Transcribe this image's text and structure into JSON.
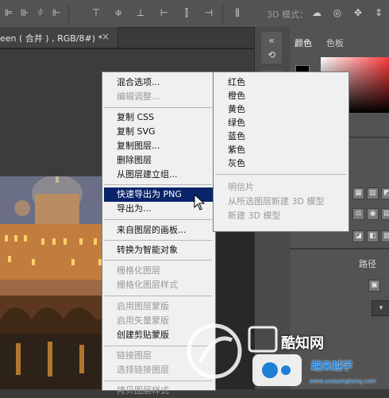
{
  "toolbar": {
    "mode_label": "3D 模式："
  },
  "document": {
    "tab_title": "een ( 合并 ) , RGB/8#) *",
    "close_glyph": "×"
  },
  "right_panel": {
    "tabs": [
      "颜色",
      "色板"
    ],
    "path_label": "路径",
    "select_glyph": "▾"
  },
  "context_menu": {
    "items": [
      {
        "label": "混合选项...",
        "enabled": true
      },
      {
        "label": "编辑调整...",
        "enabled": false
      },
      {
        "label": "复制 CSS",
        "enabled": true
      },
      {
        "label": "复制 SVG",
        "enabled": true
      },
      {
        "label": "复制图层...",
        "enabled": true
      },
      {
        "label": "删除图层",
        "enabled": true
      },
      {
        "label": "从图层建立组...",
        "enabled": true
      },
      {
        "label": "快速导出为 PNG",
        "enabled": true,
        "highlighted": true
      },
      {
        "label": "导出为...",
        "enabled": true
      },
      {
        "label": "来自图层的画板...",
        "enabled": true
      },
      {
        "label": "转换为智能对象",
        "enabled": true
      },
      {
        "label": "栅格化图层",
        "enabled": false
      },
      {
        "label": "栅格化图层样式",
        "enabled": false
      },
      {
        "label": "启用图层蒙版",
        "enabled": false
      },
      {
        "label": "启用矢量蒙版",
        "enabled": false
      },
      {
        "label": "创建剪贴蒙版",
        "enabled": true
      },
      {
        "label": "链接图层",
        "enabled": false
      },
      {
        "label": "选择链接图层",
        "enabled": false
      },
      {
        "label": "拷贝图层样式",
        "enabled": false
      }
    ]
  },
  "color_submenu": {
    "items": [
      {
        "label": "红色",
        "enabled": true
      },
      {
        "label": "橙色",
        "enabled": true
      },
      {
        "label": "黄色",
        "enabled": true
      },
      {
        "label": "绿色",
        "enabled": true
      },
      {
        "label": "蓝色",
        "enabled": true
      },
      {
        "label": "紫色",
        "enabled": true
      },
      {
        "label": "灰色",
        "enabled": true
      },
      {
        "label": "明信片",
        "enabled": false
      },
      {
        "label": "从所选图层新建 3D 模型",
        "enabled": false
      },
      {
        "label": "新建 3D 模型",
        "enabled": false
      }
    ]
  },
  "watermark": {
    "logo_text": "酷知网",
    "brand": "越来越学",
    "url": "www.yueyangbang.com"
  }
}
